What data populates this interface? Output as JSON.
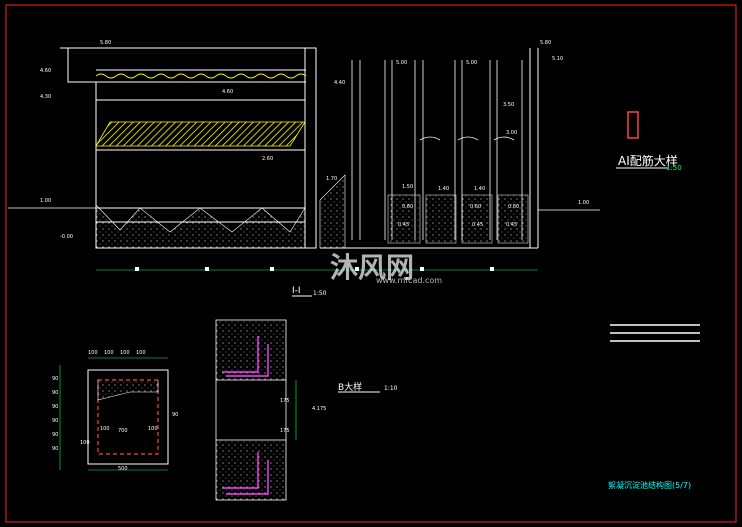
{
  "section_title": "I-I",
  "section_scale": "1:50",
  "ai_detail": {
    "title": "AI配筋大样",
    "scale": "1:50"
  },
  "b_detail": {
    "title": "B大样",
    "scale": "1:10"
  },
  "drawing_name": "絮凝沉淀池结构图(5/7)",
  "watermark": {
    "brand": "沐风网",
    "url": "www.mfcad.com"
  },
  "elevations": [
    "5.80",
    "4.60",
    "4.30",
    "4.60",
    "2.60",
    "1.70",
    "1.00",
    "-0.00",
    "1.00",
    "5.80",
    "5.10",
    "4.40",
    "5.00",
    "5.00",
    "3.50",
    "1.40",
    "1.40",
    "1.50",
    "0.80",
    "0.60",
    "0.60",
    "0.45",
    "0.45",
    "0.45",
    "3.00"
  ],
  "dims_plan": [
    "100",
    "100",
    "100",
    "100",
    "100",
    "100",
    "700",
    "100",
    "500"
  ],
  "dims_vertical": [
    "90",
    "90",
    "90",
    "90",
    "90",
    "90",
    "90"
  ],
  "b_dims": [
    "175",
    "4.175",
    "175"
  ]
}
